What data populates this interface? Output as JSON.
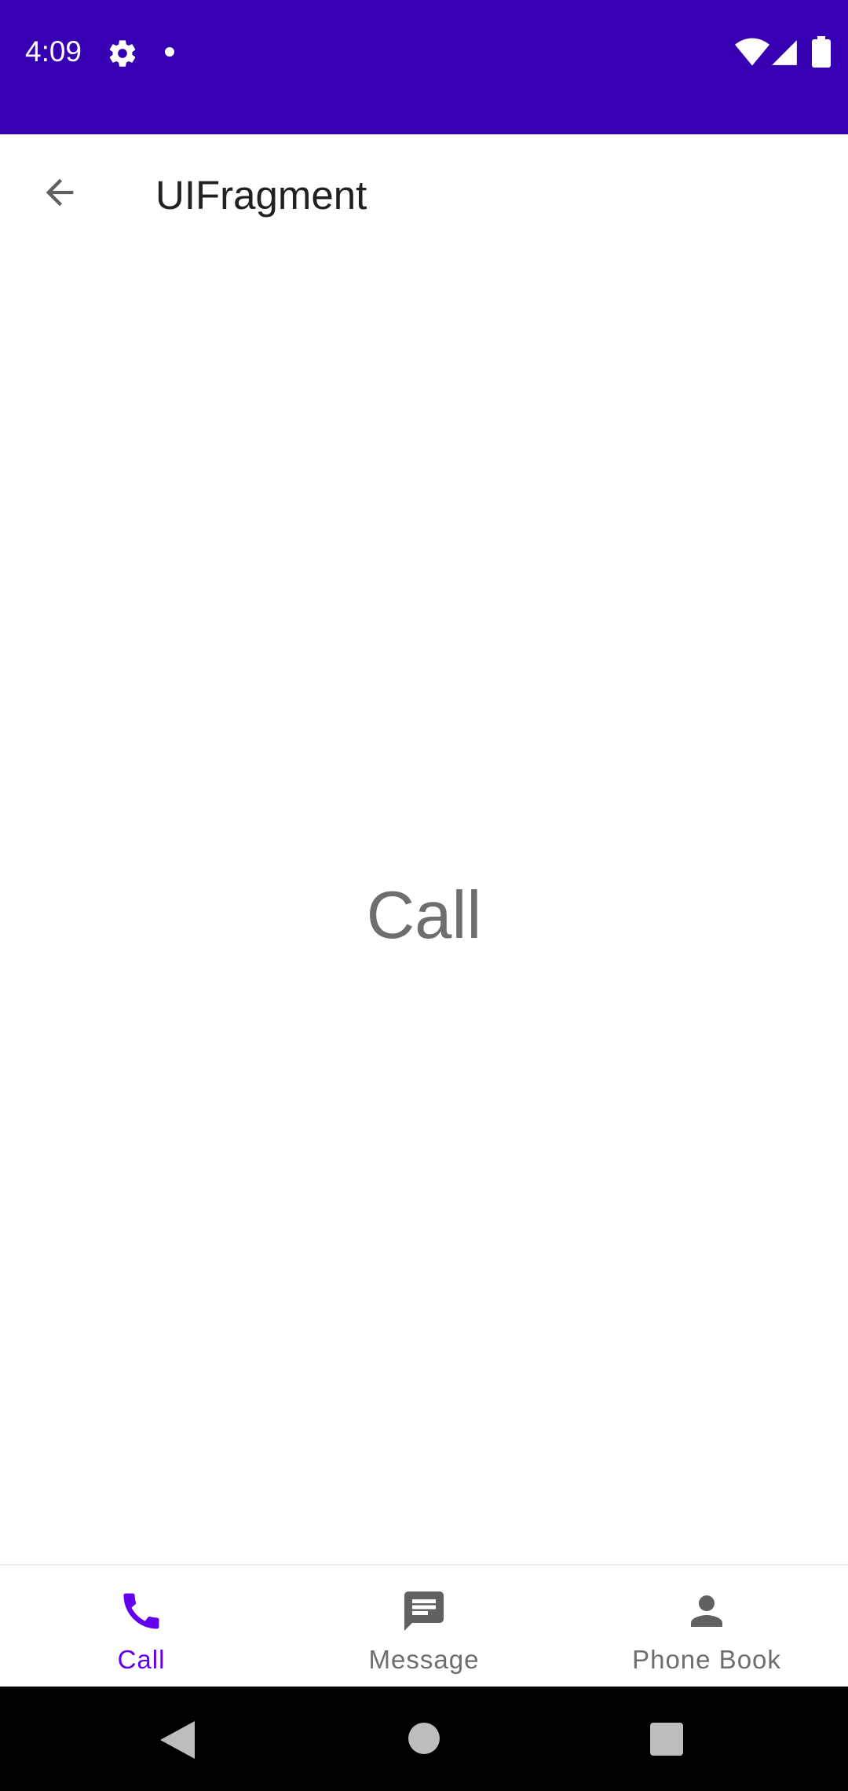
{
  "status_bar": {
    "time": "4:09",
    "icons": [
      "gear-icon",
      "notification-dot-icon",
      "wifi-icon",
      "signal-icon",
      "battery-icon"
    ],
    "background": "#3700b3"
  },
  "app_bar": {
    "title": "UIFragment",
    "back_icon": "arrow-back-icon"
  },
  "content": {
    "center_text": "Call"
  },
  "bottom_nav": {
    "items": [
      {
        "label": "Call",
        "icon": "phone-icon",
        "active": true
      },
      {
        "label": "Message",
        "icon": "message-icon",
        "active": false
      },
      {
        "label": "Phone Book",
        "icon": "person-icon",
        "active": false
      }
    ],
    "active_color": "#6200ee",
    "inactive_color": "#6e6e6e"
  },
  "system_nav": {
    "buttons": [
      "back-triangle-icon",
      "home-circle-icon",
      "recents-square-icon"
    ]
  }
}
